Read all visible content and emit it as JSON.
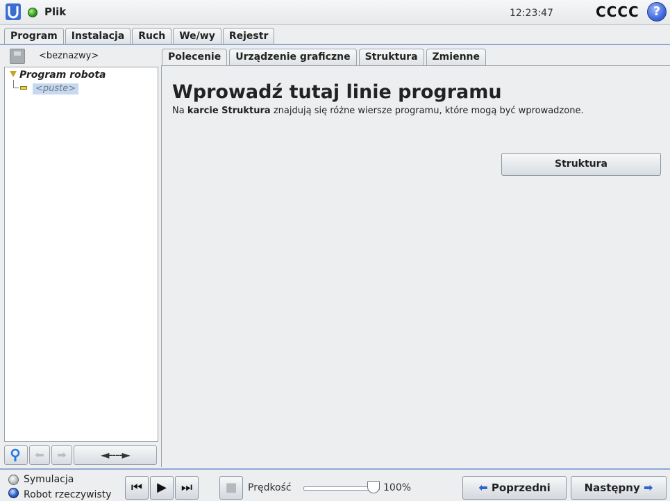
{
  "titlebar": {
    "menu_label": "Plik",
    "clock": "12:23:47",
    "robot_name": "CCCC",
    "help_label": "?"
  },
  "main_tabs": [
    {
      "label": "Program",
      "active": true
    },
    {
      "label": "Instalacja",
      "active": false
    },
    {
      "label": "Ruch",
      "active": false
    },
    {
      "label": "We/wy",
      "active": false
    },
    {
      "label": "Rejestr",
      "active": false
    }
  ],
  "left_panel": {
    "file_name": "<beznazwy>",
    "tree_root": "Program robota",
    "tree_empty": "<puste>",
    "move_label": "◄----►"
  },
  "sub_tabs": [
    {
      "label": "Polecenie",
      "active": true
    },
    {
      "label": "Urządzenie graficzne",
      "active": false
    },
    {
      "label": "Struktura",
      "active": false
    },
    {
      "label": "Zmienne",
      "active": false
    }
  ],
  "command": {
    "heading": "Wprowadź tutaj linie programu",
    "desc_before": "Na ",
    "desc_bold": "karcie Struktura",
    "desc_after": " znajdują się różne wiersze programu, które mogą być wprowadzone.",
    "structure_button": "Struktura"
  },
  "bottom": {
    "simulation_label": "Symulacja",
    "real_robot_label": "Robot rzeczywisty",
    "speed_label": "Prędkość",
    "speed_value": "100%",
    "speed_fraction": 1.0,
    "prev_label": "Poprzedni",
    "next_label": "Następny"
  },
  "colors": {
    "accent_blue": "#2a63cf",
    "status_green": "#2f9a1c",
    "selection": "#c7d9f0"
  }
}
